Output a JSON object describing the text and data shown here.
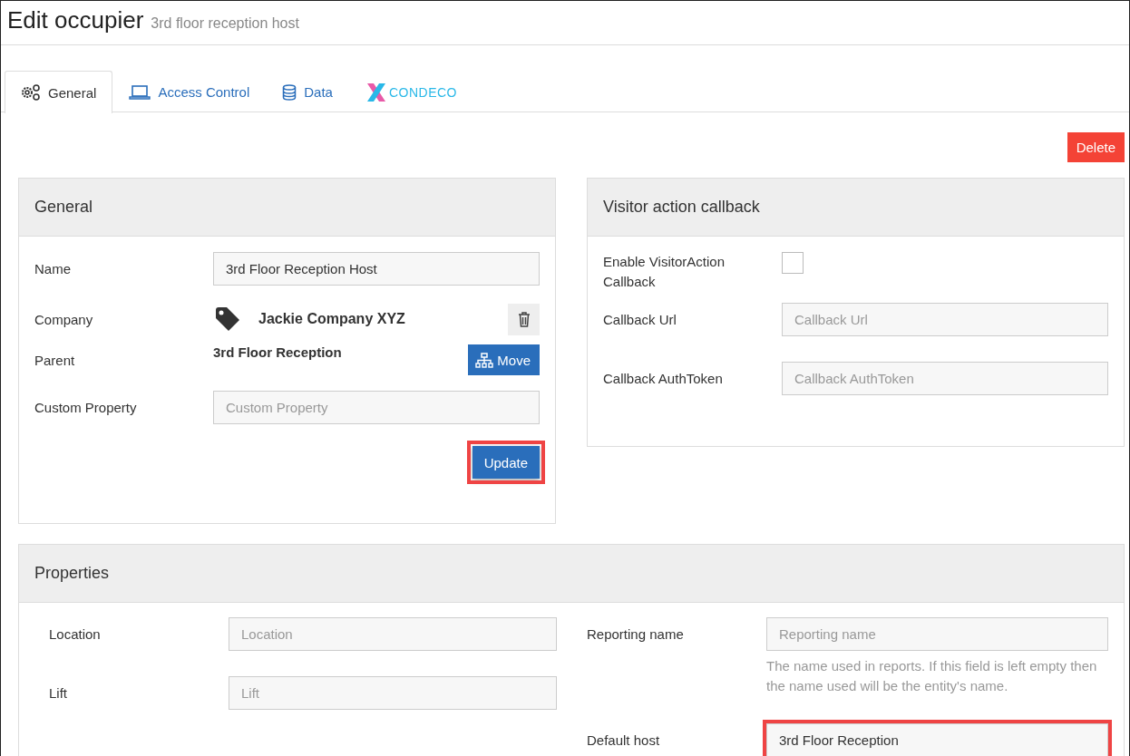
{
  "page": {
    "title": "Edit occupier",
    "subtitle": "3rd floor reception host"
  },
  "tabs": [
    {
      "label": "General",
      "kind": "gears",
      "selected": true
    },
    {
      "label": "Access Control",
      "kind": "laptop",
      "selected": false
    },
    {
      "label": "Data",
      "kind": "database",
      "selected": false
    },
    {
      "label": "CONDECO",
      "kind": "logo",
      "selected": false
    }
  ],
  "delete_button": "Delete",
  "general": {
    "title": "General",
    "fields": [
      {
        "kind": "input",
        "label": "Name",
        "value": "3rd Floor Reception Host"
      },
      {
        "kind": "tag",
        "label": "Company",
        "value": "Jackie Company XYZ"
      },
      {
        "kind": "text",
        "label": "Parent",
        "value": "3rd Floor Reception",
        "action": "Move"
      },
      {
        "kind": "input",
        "label": "Custom Property",
        "placeholder": "Custom Property"
      }
    ],
    "update_button": {
      "label": "Update",
      "highlighted": true
    }
  },
  "callback": {
    "title": "Visitor action callback",
    "fields": [
      {
        "kind": "checkbox",
        "label": "Enable VisitorAction Callback",
        "checked": false
      },
      {
        "kind": "input",
        "label": "Callback Url",
        "placeholder": "Callback Url"
      },
      {
        "kind": "input",
        "label": "Callback AuthToken",
        "placeholder": "Callback AuthToken"
      }
    ]
  },
  "properties": {
    "title": "Properties",
    "left": [
      {
        "label": "Location",
        "placeholder": "Location"
      },
      {
        "label": "Lift",
        "placeholder": "Lift"
      }
    ],
    "right": [
      {
        "label": "Reporting name",
        "placeholder": "Reporting name",
        "help": "The name used in reports. If this field is left empty then the name used will be the entity's name.",
        "highlighted": false
      },
      {
        "label": "Default host",
        "value": "3rd Floor Reception",
        "highlighted": true
      }
    ]
  }
}
